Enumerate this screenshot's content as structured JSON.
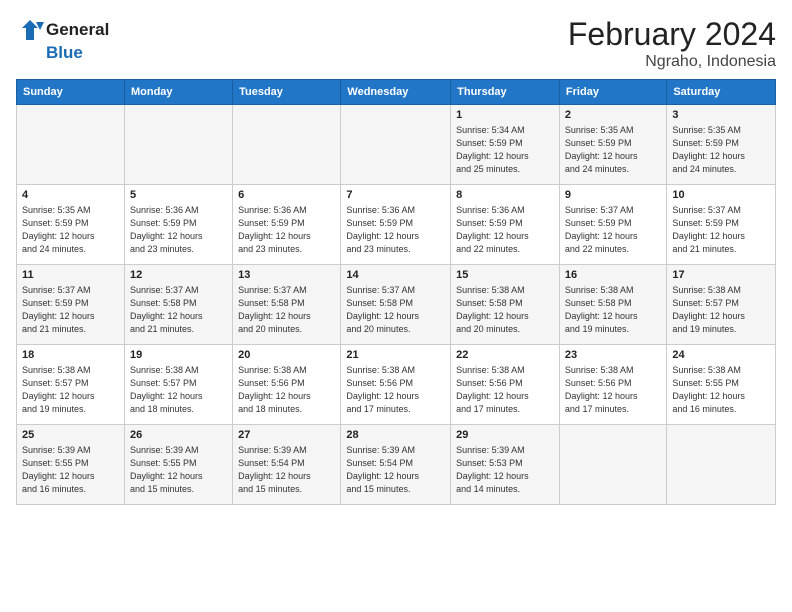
{
  "header": {
    "logo_line1": "General",
    "logo_line2": "Blue",
    "title": "February 2024",
    "subtitle": "Ngraho, Indonesia"
  },
  "weekdays": [
    "Sunday",
    "Monday",
    "Tuesday",
    "Wednesday",
    "Thursday",
    "Friday",
    "Saturday"
  ],
  "weeks": [
    [
      {
        "day": "",
        "info": ""
      },
      {
        "day": "",
        "info": ""
      },
      {
        "day": "",
        "info": ""
      },
      {
        "day": "",
        "info": ""
      },
      {
        "day": "1",
        "info": "Sunrise: 5:34 AM\nSunset: 5:59 PM\nDaylight: 12 hours\nand 25 minutes."
      },
      {
        "day": "2",
        "info": "Sunrise: 5:35 AM\nSunset: 5:59 PM\nDaylight: 12 hours\nand 24 minutes."
      },
      {
        "day": "3",
        "info": "Sunrise: 5:35 AM\nSunset: 5:59 PM\nDaylight: 12 hours\nand 24 minutes."
      }
    ],
    [
      {
        "day": "4",
        "info": "Sunrise: 5:35 AM\nSunset: 5:59 PM\nDaylight: 12 hours\nand 24 minutes."
      },
      {
        "day": "5",
        "info": "Sunrise: 5:36 AM\nSunset: 5:59 PM\nDaylight: 12 hours\nand 23 minutes."
      },
      {
        "day": "6",
        "info": "Sunrise: 5:36 AM\nSunset: 5:59 PM\nDaylight: 12 hours\nand 23 minutes."
      },
      {
        "day": "7",
        "info": "Sunrise: 5:36 AM\nSunset: 5:59 PM\nDaylight: 12 hours\nand 23 minutes."
      },
      {
        "day": "8",
        "info": "Sunrise: 5:36 AM\nSunset: 5:59 PM\nDaylight: 12 hours\nand 22 minutes."
      },
      {
        "day": "9",
        "info": "Sunrise: 5:37 AM\nSunset: 5:59 PM\nDaylight: 12 hours\nand 22 minutes."
      },
      {
        "day": "10",
        "info": "Sunrise: 5:37 AM\nSunset: 5:59 PM\nDaylight: 12 hours\nand 21 minutes."
      }
    ],
    [
      {
        "day": "11",
        "info": "Sunrise: 5:37 AM\nSunset: 5:59 PM\nDaylight: 12 hours\nand 21 minutes."
      },
      {
        "day": "12",
        "info": "Sunrise: 5:37 AM\nSunset: 5:58 PM\nDaylight: 12 hours\nand 21 minutes."
      },
      {
        "day": "13",
        "info": "Sunrise: 5:37 AM\nSunset: 5:58 PM\nDaylight: 12 hours\nand 20 minutes."
      },
      {
        "day": "14",
        "info": "Sunrise: 5:37 AM\nSunset: 5:58 PM\nDaylight: 12 hours\nand 20 minutes."
      },
      {
        "day": "15",
        "info": "Sunrise: 5:38 AM\nSunset: 5:58 PM\nDaylight: 12 hours\nand 20 minutes."
      },
      {
        "day": "16",
        "info": "Sunrise: 5:38 AM\nSunset: 5:58 PM\nDaylight: 12 hours\nand 19 minutes."
      },
      {
        "day": "17",
        "info": "Sunrise: 5:38 AM\nSunset: 5:57 PM\nDaylight: 12 hours\nand 19 minutes."
      }
    ],
    [
      {
        "day": "18",
        "info": "Sunrise: 5:38 AM\nSunset: 5:57 PM\nDaylight: 12 hours\nand 19 minutes."
      },
      {
        "day": "19",
        "info": "Sunrise: 5:38 AM\nSunset: 5:57 PM\nDaylight: 12 hours\nand 18 minutes."
      },
      {
        "day": "20",
        "info": "Sunrise: 5:38 AM\nSunset: 5:56 PM\nDaylight: 12 hours\nand 18 minutes."
      },
      {
        "day": "21",
        "info": "Sunrise: 5:38 AM\nSunset: 5:56 PM\nDaylight: 12 hours\nand 17 minutes."
      },
      {
        "day": "22",
        "info": "Sunrise: 5:38 AM\nSunset: 5:56 PM\nDaylight: 12 hours\nand 17 minutes."
      },
      {
        "day": "23",
        "info": "Sunrise: 5:38 AM\nSunset: 5:56 PM\nDaylight: 12 hours\nand 17 minutes."
      },
      {
        "day": "24",
        "info": "Sunrise: 5:38 AM\nSunset: 5:55 PM\nDaylight: 12 hours\nand 16 minutes."
      }
    ],
    [
      {
        "day": "25",
        "info": "Sunrise: 5:39 AM\nSunset: 5:55 PM\nDaylight: 12 hours\nand 16 minutes."
      },
      {
        "day": "26",
        "info": "Sunrise: 5:39 AM\nSunset: 5:55 PM\nDaylight: 12 hours\nand 15 minutes."
      },
      {
        "day": "27",
        "info": "Sunrise: 5:39 AM\nSunset: 5:54 PM\nDaylight: 12 hours\nand 15 minutes."
      },
      {
        "day": "28",
        "info": "Sunrise: 5:39 AM\nSunset: 5:54 PM\nDaylight: 12 hours\nand 15 minutes."
      },
      {
        "day": "29",
        "info": "Sunrise: 5:39 AM\nSunset: 5:53 PM\nDaylight: 12 hours\nand 14 minutes."
      },
      {
        "day": "",
        "info": ""
      },
      {
        "day": "",
        "info": ""
      }
    ]
  ]
}
